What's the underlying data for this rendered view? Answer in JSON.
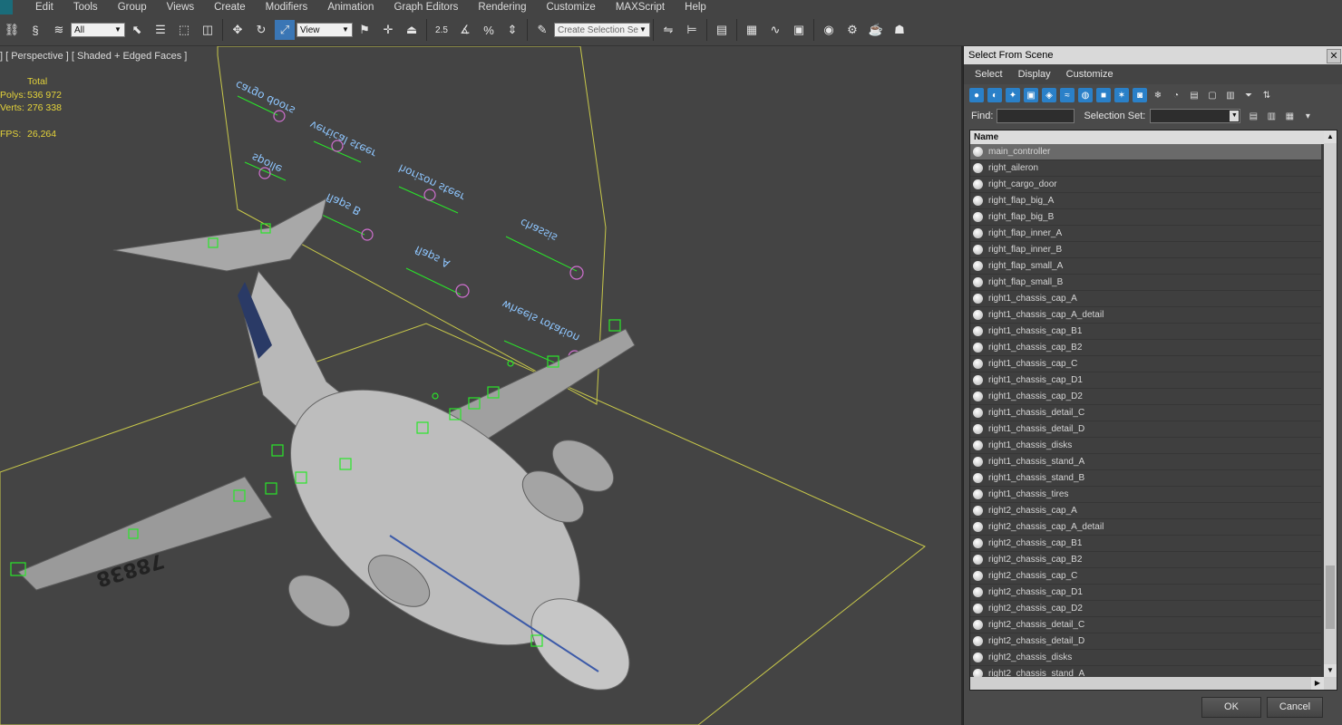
{
  "menubar": {
    "items": [
      "Edit",
      "Tools",
      "Group",
      "Views",
      "Create",
      "Modifiers",
      "Animation",
      "Graph Editors",
      "Rendering",
      "Customize",
      "MAXScript",
      "Help"
    ]
  },
  "toolbar": {
    "filter_value": "All",
    "view_value": "View",
    "snap_label": "2.5",
    "selection_set_placeholder": "Create Selection Se"
  },
  "viewport": {
    "label": "] [ Perspective ] [ Shaded + Edged Faces ]",
    "stats": {
      "header": "Total",
      "polys_label": "Polys:",
      "polys_value": "536 972",
      "verts_label": "Verts:",
      "verts_value": "276 338",
      "fps_label": "FPS:",
      "fps_value": "26,264"
    },
    "plane_labels": [
      "cargo doors",
      "vertical steer",
      "horizon steer",
      "chassis",
      "spoile",
      "flaps B",
      "flaps A",
      "wheels rotation"
    ],
    "aircraft_number": "78838"
  },
  "dialog": {
    "title": "Select From Scene",
    "menu": [
      "Select",
      "Display",
      "Customize"
    ],
    "find_label": "Find:",
    "selection_set_label": "Selection Set:",
    "list_header": "Name",
    "items": [
      "main_controller",
      "right_aileron",
      "right_cargo_door",
      "right_flap_big_A",
      "right_flap_big_B",
      "right_flap_inner_A",
      "right_flap_inner_B",
      "right_flap_small_A",
      "right_flap_small_B",
      "right1_chassis_cap_A",
      "right1_chassis_cap_A_detail",
      "right1_chassis_cap_B1",
      "right1_chassis_cap_B2",
      "right1_chassis_cap_C",
      "right1_chassis_cap_D1",
      "right1_chassis_cap_D2",
      "right1_chassis_detail_C",
      "right1_chassis_detail_D",
      "right1_chassis_disks",
      "right1_chassis_stand_A",
      "right1_chassis_stand_B",
      "right1_chassis_tires",
      "right2_chassis_cap_A",
      "right2_chassis_cap_A_detail",
      "right2_chassis_cap_B1",
      "right2_chassis_cap_B2",
      "right2_chassis_cap_C",
      "right2_chassis_cap_D1",
      "right2_chassis_cap_D2",
      "right2_chassis_detail_C",
      "right2_chassis_detail_D",
      "right2_chassis_disks",
      "right2_chassis_stand_A"
    ],
    "ok_label": "OK",
    "cancel_label": "Cancel"
  },
  "colors": {
    "accent_blue": "#2a80c8",
    "stats_yellow": "#e4d33a",
    "helper_green": "#29e629",
    "plane_outline": "#c8c84a"
  }
}
